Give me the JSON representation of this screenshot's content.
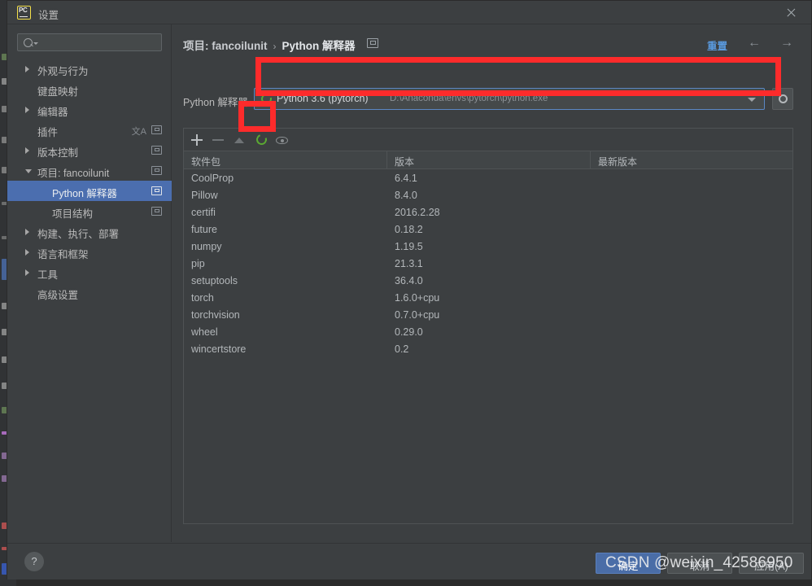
{
  "window": {
    "title": "设置",
    "logo_text": "PC",
    "close_icon": "close-icon"
  },
  "sidebar": {
    "search": {
      "value": "",
      "placeholder": ""
    },
    "items": [
      {
        "label": "外观与行为",
        "arrow": "closed",
        "level": 0,
        "badge": false,
        "selected": false
      },
      {
        "label": "键盘映射",
        "arrow": "none",
        "level": 0,
        "badge": false,
        "selected": false
      },
      {
        "label": "编辑器",
        "arrow": "closed",
        "level": 0,
        "badge": false,
        "selected": false
      },
      {
        "label": "插件",
        "arrow": "none",
        "level": 0,
        "badge": true,
        "lang": true,
        "selected": false
      },
      {
        "label": "版本控制",
        "arrow": "closed",
        "level": 0,
        "badge": true,
        "selected": false
      },
      {
        "label": "项目: fancoilunit",
        "arrow": "open",
        "level": 0,
        "badge": true,
        "selected": false
      },
      {
        "label": "Python 解释器",
        "arrow": "none",
        "level": 1,
        "badge": true,
        "selected": true
      },
      {
        "label": "项目结构",
        "arrow": "none",
        "level": 1,
        "badge": true,
        "selected": false
      },
      {
        "label": "构建、执行、部署",
        "arrow": "closed",
        "level": 0,
        "badge": false,
        "selected": false
      },
      {
        "label": "语言和框架",
        "arrow": "closed",
        "level": 0,
        "badge": false,
        "selected": false
      },
      {
        "label": "工具",
        "arrow": "closed",
        "level": 0,
        "badge": false,
        "selected": false
      },
      {
        "label": "高级设置",
        "arrow": "none",
        "level": 0,
        "badge": false,
        "selected": false
      }
    ]
  },
  "header": {
    "breadcrumb_project": "项目: fancoilunit",
    "breadcrumb_sep": "›",
    "breadcrumb_current": "Python 解释器",
    "reset_label": "重置",
    "back_icon": "←",
    "forward_icon": "→"
  },
  "interpreter": {
    "label": "Python 解释器",
    "name": "Python 3.6 (pytorch)",
    "path": "D:\\Anaconda\\envs\\pytorch\\python.exe",
    "icon": "python-env-icon",
    "dropdown_icon": "chevron-down-icon",
    "gear_icon": "gear-icon"
  },
  "packages": {
    "toolbar": {
      "add": "+",
      "remove": "−",
      "upgrade": "▲",
      "refresh": "refresh-icon",
      "show_early": "eye-icon"
    },
    "columns": [
      "软件包",
      "版本",
      "最新版本"
    ],
    "rows": [
      {
        "name": "CoolProp",
        "version": "6.4.1",
        "latest": ""
      },
      {
        "name": "Pillow",
        "version": "8.4.0",
        "latest": ""
      },
      {
        "name": "certifi",
        "version": "2016.2.28",
        "latest": ""
      },
      {
        "name": "future",
        "version": "0.18.2",
        "latest": ""
      },
      {
        "name": "numpy",
        "version": "1.19.5",
        "latest": ""
      },
      {
        "name": "pip",
        "version": "21.3.1",
        "latest": ""
      },
      {
        "name": "setuptools",
        "version": "36.4.0",
        "latest": ""
      },
      {
        "name": "torch",
        "version": "1.6.0+cpu",
        "latest": ""
      },
      {
        "name": "torchvision",
        "version": "0.7.0+cpu",
        "latest": ""
      },
      {
        "name": "wheel",
        "version": "0.29.0",
        "latest": ""
      },
      {
        "name": "wincertstore",
        "version": "0.2",
        "latest": ""
      }
    ]
  },
  "footer": {
    "help_icon": "?",
    "ok_label": "确定",
    "cancel_label": "取消",
    "apply_label": "应用(A)"
  },
  "watermark": {
    "text": "CSDN @weixin_42586950"
  },
  "colors": {
    "dialog_bg": "#3c3f41",
    "selection_blue": "#4b6eaf",
    "accent_link": "#5a9adf",
    "primary_button": "#4a6da7",
    "annotation_red": "#fd2b2b",
    "python_green": "#5aa832"
  }
}
